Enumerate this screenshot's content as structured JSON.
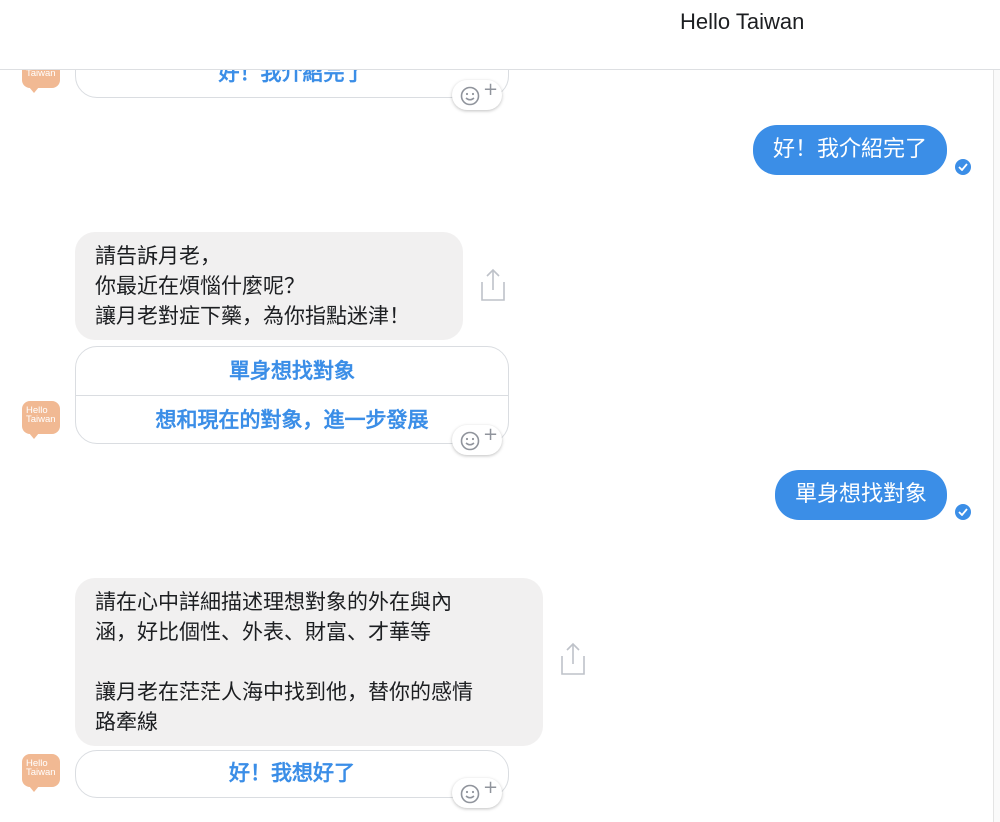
{
  "header": {
    "title": "Hello Taiwan"
  },
  "avatar": {
    "line1": "Hello",
    "line2": "Taiwan"
  },
  "messages": {
    "top_partial_reply": "好！我介紹完了",
    "user_1": "好！我介紹完了",
    "bot_1": [
      "請告訴月老，",
      "你最近在煩惱什麼呢？",
      "讓月老對症下藥，為你指點迷津！"
    ],
    "bot_1_replies": [
      "單身想找對象",
      "想和現在的對象，進一步發展"
    ],
    "user_2": "單身想找對象",
    "bot_2": [
      "請在心中詳細描述理想對象的外在與內",
      "涵，好比個性、外表、財富、才華等",
      "",
      "讓月老在茫茫人海中找到他，替你的感情",
      "路牽線"
    ],
    "bot_2_replies": [
      "好！我想好了"
    ]
  },
  "icons": {
    "reaction": "smiley-plus-icon",
    "share": "share-icon",
    "seen": "check-circle-icon"
  },
  "colors": {
    "accent": "#3b8ee7",
    "incoming_bubble": "#f1f0f0",
    "avatar": "#f1b993"
  }
}
